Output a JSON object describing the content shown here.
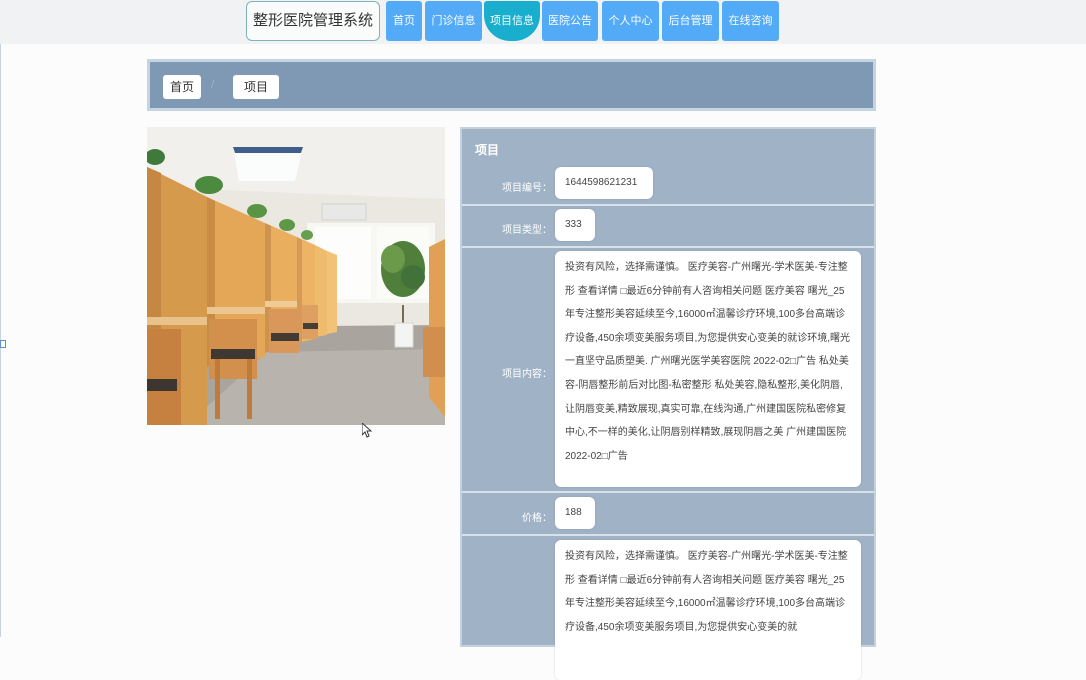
{
  "header": {
    "title": "整形医院管理系统",
    "nav": [
      {
        "label": "首页",
        "active": false
      },
      {
        "label": "门诊信息",
        "active": false
      },
      {
        "label": "项目信息",
        "active": true
      },
      {
        "label": "医院公告",
        "active": false
      },
      {
        "label": "个人中心",
        "active": false
      },
      {
        "label": "后台管理",
        "active": false
      },
      {
        "label": "在线咨询",
        "active": false
      }
    ]
  },
  "breadcrumb": {
    "items": [
      "首页",
      "项目"
    ],
    "separator": "/"
  },
  "detail": {
    "title": "项目",
    "fields": {
      "project_number": {
        "label": "项目编号：",
        "value": "1644598621231"
      },
      "project_type": {
        "label": "项目类型：",
        "value": "333"
      },
      "project_content": {
        "label": "项目内容：",
        "value": "投资有风险，选择需谨慎。 医疗美容-广州曙光-学术医美-专注整形 查看详情 □最近6分钟前有人咨询相关问题 医疗美容 曙光_25年专注整形美容延续至今,16000㎡温馨诊疗环境,100多台高端诊疗设备,450余项变美服务项目,为您提供安心变美的就诊环境,曙光一直坚守品质塑美. 广州曙光医学美容医院 2022-02□广告 私处美容-阴唇整形前后对比图-私密整形 私处美容,隐私整形,美化阴唇,让阴唇变美,精致展现,真实可靠,在线沟通,广州建国医院私密修复中心,不一样的美化,让阴唇别样精致,展现阴唇之美 广州建国医院 2022-02□广告"
      },
      "price": {
        "label": "价格：",
        "value": "188"
      },
      "second_content": {
        "label": "",
        "value": "投资有风险，选择需谨慎。 医疗美容-广州曙光-学术医美-专注整形 查看详情 □最近6分钟前有人咨询相关问题 医疗美容 曙光_25年专注整形美容延续至今,16000㎡温馨诊疗环境,100多台高端诊疗设备,450余项变美服务项目,为您提供安心变美的就"
      }
    }
  },
  "colors": {
    "nav": "#53aaf7",
    "nav_active": "#19aecd",
    "breadcrumb_bar": "#7f98b4",
    "detail_panel": "#a0b3c6"
  }
}
